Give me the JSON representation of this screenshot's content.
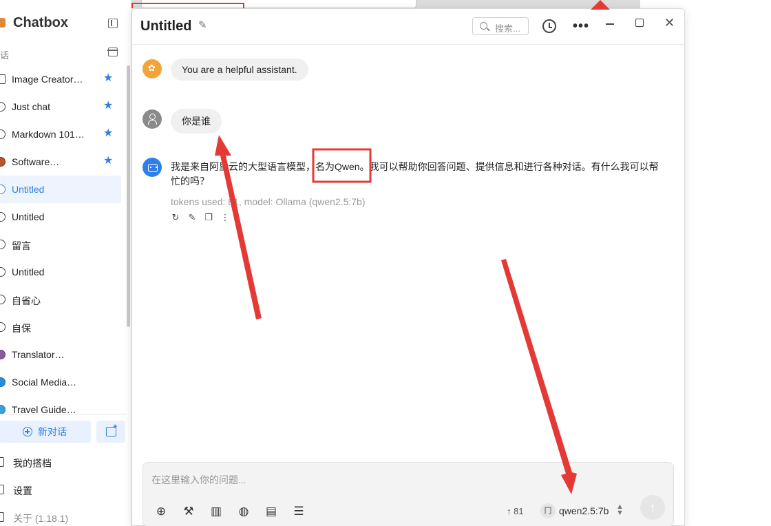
{
  "sidebar": {
    "app_title": "Chatbox",
    "section_label": "话",
    "sessions": [
      {
        "label": "Image Creator…",
        "starred": true
      },
      {
        "label": "Just chat",
        "starred": true
      },
      {
        "label": "Markdown 101…",
        "starred": true
      },
      {
        "label": "Software…",
        "starred": true
      },
      {
        "label": "Untitled",
        "starred": false,
        "active": true
      },
      {
        "label": "Untitled",
        "starred": false
      },
      {
        "label": "留言",
        "starred": false
      },
      {
        "label": "Untitled",
        "starred": false
      },
      {
        "label": "自省心",
        "starred": false
      },
      {
        "label": "自保",
        "starred": false
      },
      {
        "label": "Translator…",
        "starred": false
      },
      {
        "label": "Social Media…",
        "starred": false
      },
      {
        "label": "Travel Guide…",
        "starred": false
      }
    ],
    "new_chat_label": "新对话",
    "my_partners_label": "我的搭档",
    "settings_label": "设置",
    "about_label": "关于 (1.18.1)"
  },
  "header": {
    "title": "Untitled",
    "search_placeholder": "搜索..."
  },
  "messages": {
    "system": "You are a helpful assistant.",
    "user": "你是谁",
    "assistant": "我是来自阿里云的大型语言模型，名为Qwen。我可以帮助你回答问题、提供信息和进行各种对话。有什么我可以帮忙的吗？",
    "meta": "tokens used: 81, model: Ollama (qwen2.5:7b)"
  },
  "composer": {
    "placeholder": "在这里输入你的问题...",
    "token_count": "↑ 81",
    "model": "qwen2.5:7b"
  },
  "colors": {
    "accent": "#2f7fe8",
    "annotation": "#e53935"
  }
}
